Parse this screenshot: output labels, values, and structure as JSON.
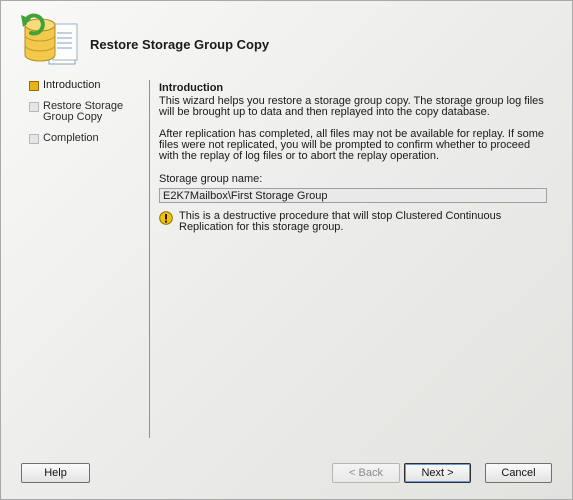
{
  "wizard": {
    "title": "Restore Storage Group Copy"
  },
  "steps": [
    {
      "label": "Introduction",
      "state": "active"
    },
    {
      "label": "Restore Storage Group Copy",
      "state": "pending"
    },
    {
      "label": "Completion",
      "state": "pending"
    }
  ],
  "main": {
    "title": "Introduction",
    "paragraph1": "This wizard helps you restore a storage group copy. The storage group log files will be brought up to data and then replayed into the copy database.",
    "paragraph2": "After replication has completed, all files may not be available for replay. If some files were not replicated, you will be prompted to confirm whether to proceed with the replay of log files or to abort the replay operation.",
    "field_label": "Storage group name:",
    "field_value": "E2K7Mailbox\\First Storage Group",
    "warning_text": "This is a destructive procedure that will stop Clustered Continuous Replication for this storage group."
  },
  "buttons": {
    "help": "Help",
    "back": "< Back",
    "next": "Next >",
    "cancel": "Cancel"
  },
  "icons": {
    "wizard": "storage-group-restore-icon",
    "warning": "warning-icon"
  },
  "colors": {
    "active_step": "#e8b31c",
    "warning": "#f2c200"
  }
}
